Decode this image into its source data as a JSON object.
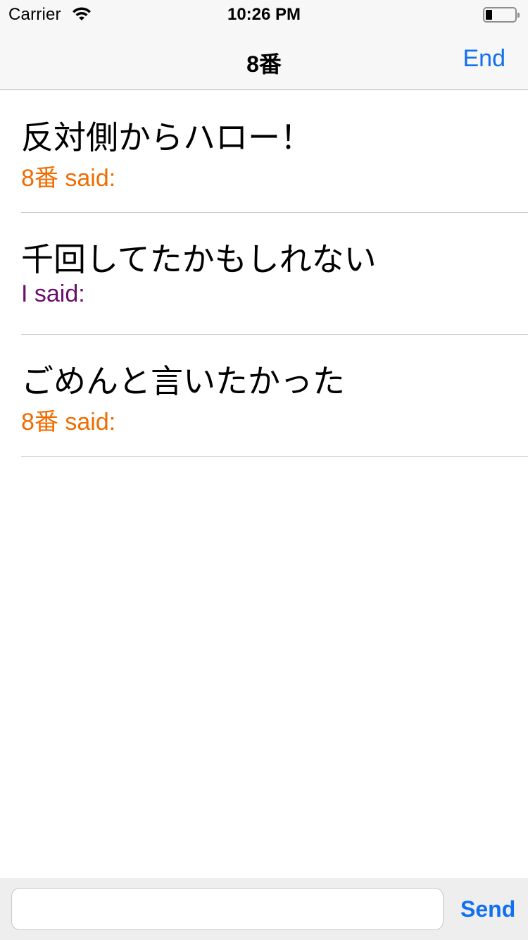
{
  "status_bar": {
    "carrier": "Carrier",
    "time": "10:26 PM",
    "wifi_icon": "wifi-icon",
    "battery_icon": "battery-icon",
    "battery_level": 0.2
  },
  "nav": {
    "title": "8番",
    "end_label": "End"
  },
  "messages": [
    {
      "text": "反対側からハロー！",
      "sender": "8番 said:",
      "sender_color": "#ef6c00"
    },
    {
      "text": "千回してたかもしれない",
      "sender": "I said:",
      "sender_color": "#6a0f6e"
    },
    {
      "text": "ごめんと言いたかった",
      "sender": "8番 said:",
      "sender_color": "#ef6c00"
    }
  ],
  "input": {
    "value": "",
    "placeholder": "",
    "send_label": "Send"
  },
  "colors": {
    "accent": "#1070f0",
    "other_sender": "#ef6c00",
    "self_sender": "#6a0f6e"
  }
}
